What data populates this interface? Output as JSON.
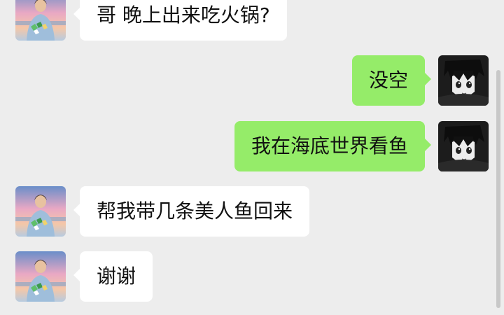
{
  "messages": [
    {
      "side": "left",
      "text": "哥 晚上出来吃火锅?"
    },
    {
      "side": "right",
      "text": "没空"
    },
    {
      "side": "right",
      "text": "我在海底世界看鱼"
    },
    {
      "side": "left",
      "text": "帮我带几条美人鱼回来"
    },
    {
      "side": "left",
      "text": "谢谢"
    }
  ],
  "colors": {
    "background": "#ededed",
    "incoming_bubble": "#ffffff",
    "outgoing_bubble": "#95ec69"
  },
  "icons": {
    "incoming_avatar": "illustrated-man-avatar",
    "outgoing_avatar": "anime-boy-avatar"
  }
}
